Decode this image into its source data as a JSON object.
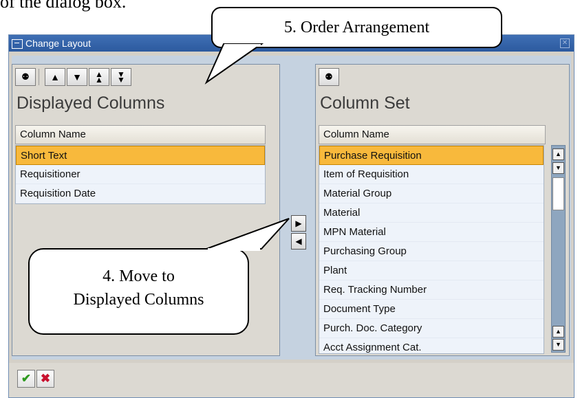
{
  "doc_text": "of the dialog box.",
  "window": {
    "title": "Change Layout",
    "close_glyph": "✕"
  },
  "left_panel": {
    "title": "Displayed Columns",
    "column_header": "Column Name",
    "rows": [
      "Short Text",
      "Requisitioner",
      "Requisition Date"
    ],
    "selected_index": 0,
    "toolbar": [
      {
        "icon": "binoculars-icon",
        "glyph": "🔍"
      },
      {
        "icon": "move-up-icon",
        "glyph": "▲"
      },
      {
        "icon": "move-down-icon",
        "glyph": "▼"
      },
      {
        "icon": "move-top-icon",
        "glyph": "⏫"
      },
      {
        "icon": "move-bottom-icon",
        "glyph": "⏬"
      }
    ]
  },
  "right_panel": {
    "title": "Column Set",
    "column_header": "Column Name",
    "rows": [
      "Purchase Requisition",
      "Item of Requisition",
      "Material Group",
      "Material",
      "MPN Material",
      "Purchasing Group",
      "Plant",
      "Req. Tracking Number",
      "Document Type",
      "Purch. Doc. Category",
      "Acct Assignment Cat."
    ],
    "selected_index": 0,
    "toolbar": [
      {
        "icon": "binoculars-icon",
        "glyph": "🔍"
      }
    ]
  },
  "move_buttons": {
    "to_displayed": "◀",
    "to_column_set": "▶"
  },
  "footer": {
    "ok_glyph": "✔",
    "cancel_glyph": "✖"
  },
  "callouts": {
    "order": "5. Order Arrangement",
    "move_line1": "4. Move to",
    "move_line2": "Displayed Columns"
  },
  "colors": {
    "selection": "#f8b93c",
    "title_bar": "#2c5a9f",
    "ok": "#2e9a1f",
    "cancel": "#c8102e"
  }
}
